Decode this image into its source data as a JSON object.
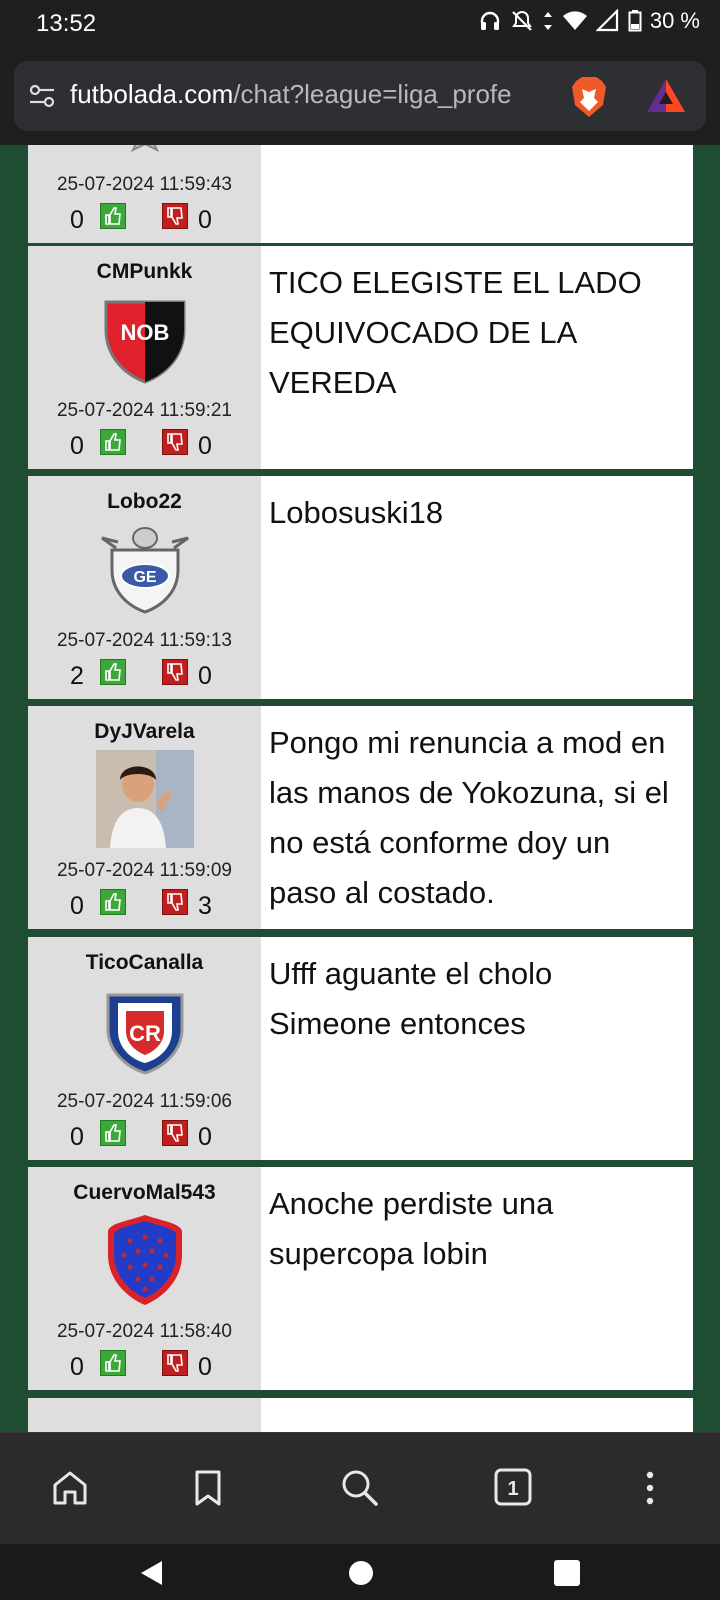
{
  "status": {
    "time": "13:52",
    "battery": "30 %"
  },
  "browser": {
    "url_host": "futbolada.com",
    "url_path": "/chat?league=liga_profe",
    "tab_count": "1"
  },
  "messages": [
    {
      "user": "",
      "date": "25-07-2024 11:59:43",
      "likes": "0",
      "dislikes": "0",
      "text": "",
      "avatar": "crest-star-partial"
    },
    {
      "user": "CMPunkk",
      "date": "25-07-2024 11:59:21",
      "likes": "0",
      "dislikes": "0",
      "text": "TICO ELEGISTE EL LADO EQUIVOCADO DE LA VEREDA",
      "avatar": "nob-crest",
      "avatar_label": "NOB"
    },
    {
      "user": "Lobo22",
      "date": "25-07-2024 11:59:13",
      "likes": "2",
      "dislikes": "0",
      "text": "Lobosuski18",
      "avatar": "gimnasia-crest",
      "avatar_label": "GE"
    },
    {
      "user": "DyJVarela",
      "date": "25-07-2024 11:59:09",
      "likes": "0",
      "dislikes": "3",
      "text": "Pongo mi renuncia a mod en las manos de Yokozuna, si el no está conforme doy un paso al costado.",
      "avatar": "person-photo"
    },
    {
      "user": "TicoCanalla",
      "date": "25-07-2024 11:59:06",
      "likes": "0",
      "dislikes": "0",
      "text": "Ufff aguante el cholo Simeone entonces",
      "avatar": "costa-rica-crest",
      "avatar_label": "CR"
    },
    {
      "user": "CuervoMal543",
      "date": "25-07-2024 11:58:40",
      "likes": "0",
      "dislikes": "0",
      "text": "Anoche perdiste una supercopa lobin",
      "avatar": "san-lorenzo-crest"
    }
  ],
  "colors": {
    "page_bg": "#1e4d33",
    "like": "#3da83a",
    "dislike": "#c01f1f"
  }
}
